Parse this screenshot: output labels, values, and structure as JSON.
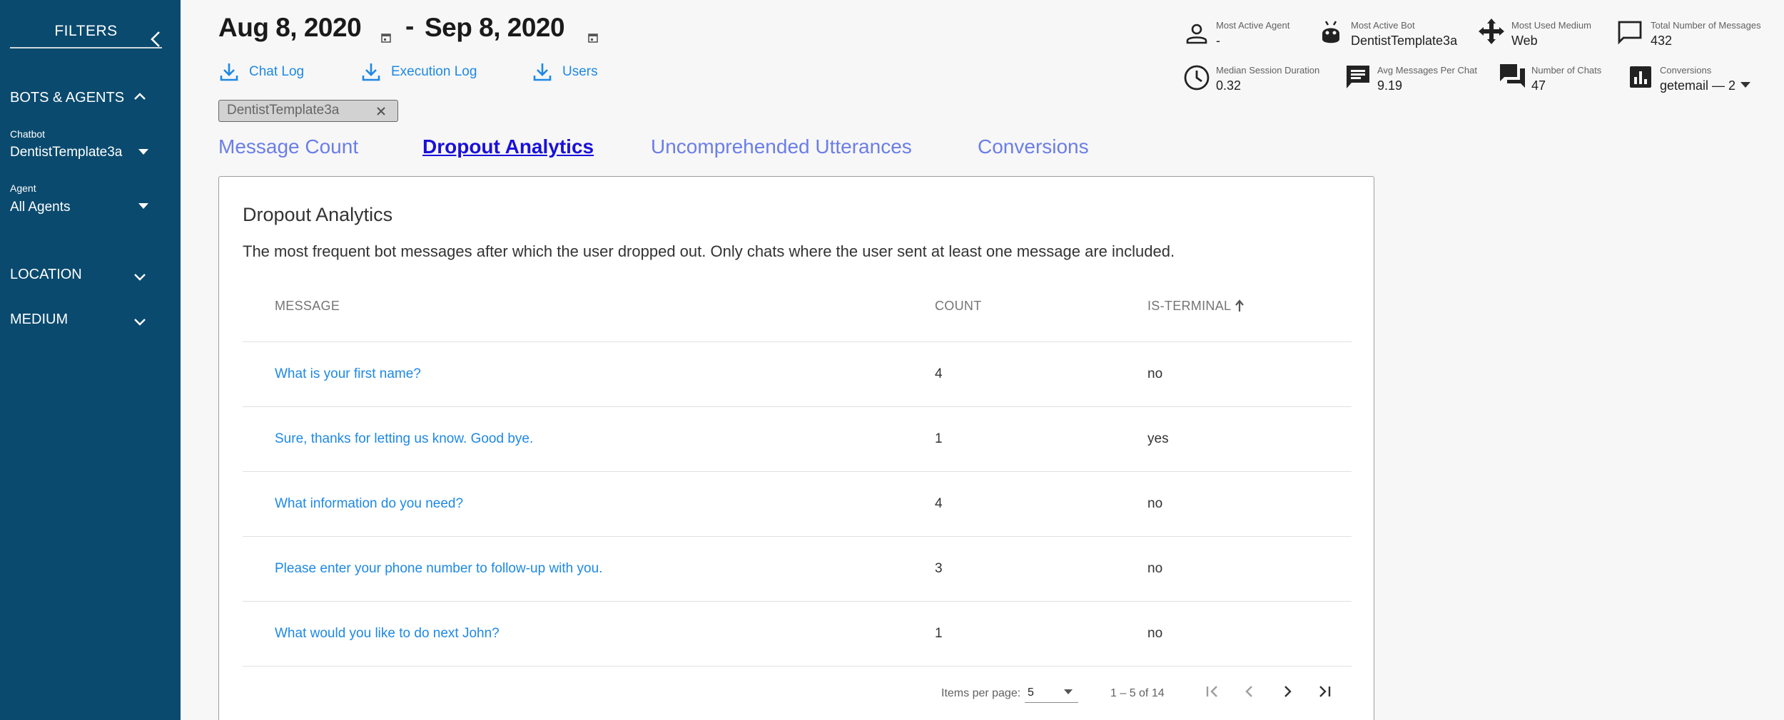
{
  "sidebar": {
    "title": "FILTERS",
    "sections": {
      "bots_agents": "BOTS & AGENTS",
      "location": "LOCATION",
      "medium": "MEDIUM"
    },
    "chatbot": {
      "label": "Chatbot",
      "value": "DentistTemplate3a"
    },
    "agent": {
      "label": "Agent",
      "value": "All Agents"
    }
  },
  "header": {
    "date_from": "Aug 8, 2020",
    "date_sep": "-",
    "date_to": "Sep 8, 2020",
    "downloads": [
      "Chat Log",
      "Execution Log",
      "Users"
    ],
    "chip": "DentistTemplate3a"
  },
  "stats": {
    "most_active_agent": {
      "label": "Most Active Agent",
      "value": "-"
    },
    "most_active_bot": {
      "label": "Most Active Bot",
      "value": "DentistTemplate3a"
    },
    "most_used_medium": {
      "label": "Most Used Medium",
      "value": "Web"
    },
    "total_messages": {
      "label": "Total Number of Messages",
      "value": "432"
    },
    "median_session": {
      "label": "Median Session Duration",
      "value": "0.32"
    },
    "avg_messages": {
      "label": "Avg Messages Per Chat",
      "value": "9.19"
    },
    "num_chats": {
      "label": "Number of Chats",
      "value": "47"
    },
    "conversions": {
      "label": "Conversions",
      "value": "getemail — 2"
    }
  },
  "tabs": [
    "Message Count",
    "Dropout Analytics",
    "Uncomprehended Utterances",
    "Conversions"
  ],
  "active_tab": "Dropout Analytics",
  "card": {
    "title": "Dropout Analytics",
    "description": "The most frequent bot messages after which the user dropped out. Only chats where the user sent at least one message are included.",
    "columns": [
      "MESSAGE",
      "COUNT",
      "IS-TERMINAL"
    ],
    "rows": [
      {
        "message": "What is your first name?",
        "count": "4",
        "terminal": "no"
      },
      {
        "message": "Sure, thanks for letting us know. Good bye.",
        "count": "1",
        "terminal": "yes"
      },
      {
        "message": "What information do you need?",
        "count": "4",
        "terminal": "no"
      },
      {
        "message": "Please enter your phone number to follow-up with you.",
        "count": "3",
        "terminal": "no"
      },
      {
        "message": "What would you like to do next John?",
        "count": "1",
        "terminal": "no"
      }
    ]
  },
  "pagination": {
    "items_per_page_label": "Items per page:",
    "items_per_page": "5",
    "range": "1 – 5 of 14"
  },
  "colors": {
    "sidebar_bg": "#0a4a6e",
    "link": "#1e88e5",
    "tab": "#6b7ee8",
    "tab_active": "#1a10d8"
  }
}
